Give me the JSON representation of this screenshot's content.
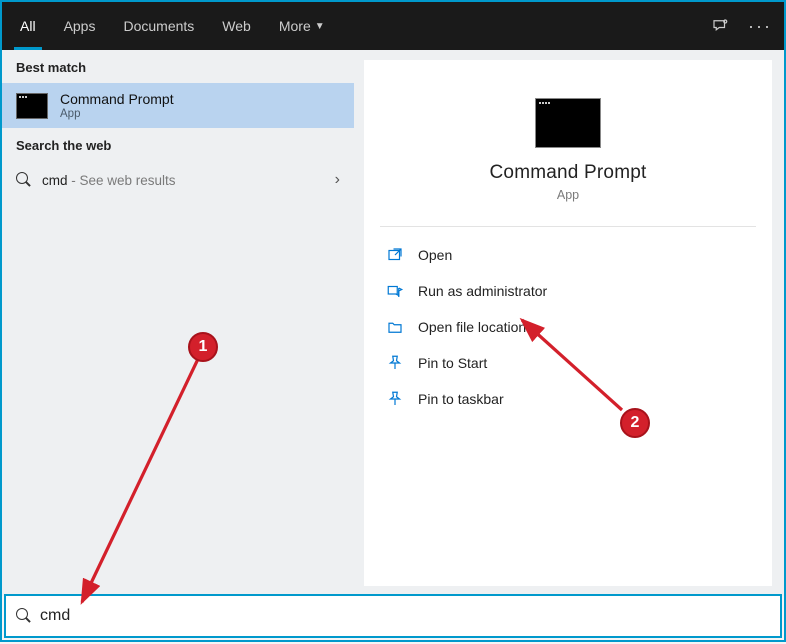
{
  "tabs": {
    "all": "All",
    "apps": "Apps",
    "documents": "Documents",
    "web": "Web",
    "more": "More"
  },
  "left": {
    "best_match_header": "Best match",
    "best_title": "Command Prompt",
    "best_sub": "App",
    "search_web_header": "Search the web",
    "web_query": "cmd",
    "web_hint": " - See web results"
  },
  "preview": {
    "title": "Command Prompt",
    "sub": "App"
  },
  "actions": {
    "open": "Open",
    "run_admin": "Run as administrator",
    "open_loc": "Open file location",
    "pin_start": "Pin to Start",
    "pin_taskbar": "Pin to taskbar"
  },
  "search": {
    "value": "cmd"
  },
  "annotations": {
    "badge1": "1",
    "badge2": "2"
  },
  "colors": {
    "accent": "#0099cc",
    "action_icon": "#0078d4",
    "annotation": "#d3202b"
  }
}
